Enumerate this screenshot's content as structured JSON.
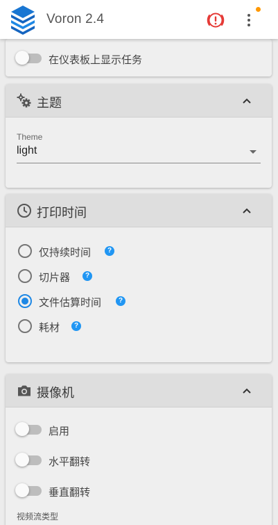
{
  "app": {
    "title": "Voron 2.4",
    "accent_color": "#1e88e5",
    "notification_color": "#ff9800",
    "emergency_color": "#e53935"
  },
  "toolbar": {
    "emergency_icon": "emergency-stop-icon",
    "menu_icon": "more-vert-icon"
  },
  "dashboard_card": {
    "toggle_label": "在仪表板上显示任务",
    "toggle_on": false
  },
  "theme_card": {
    "title": "主题",
    "icon": "cogs-icon",
    "select_label": "Theme",
    "select_value": "light"
  },
  "print_time_card": {
    "title": "打印时间",
    "icon": "clock-icon",
    "options": [
      {
        "label": "仅持续时间",
        "checked": false,
        "help": "?"
      },
      {
        "label": "切片器",
        "checked": false,
        "help": "?"
      },
      {
        "label": "文件估算时间",
        "checked": true,
        "help": "?"
      },
      {
        "label": "耗材",
        "checked": false,
        "help": "?"
      }
    ]
  },
  "camera_card": {
    "title": "摄像机",
    "icon": "camera-icon",
    "toggles": [
      {
        "label": "启用",
        "on": false
      },
      {
        "label": "水平翻转",
        "on": false
      },
      {
        "label": "垂直翻转",
        "on": false
      }
    ],
    "stream_type_label": "视频流类型"
  }
}
